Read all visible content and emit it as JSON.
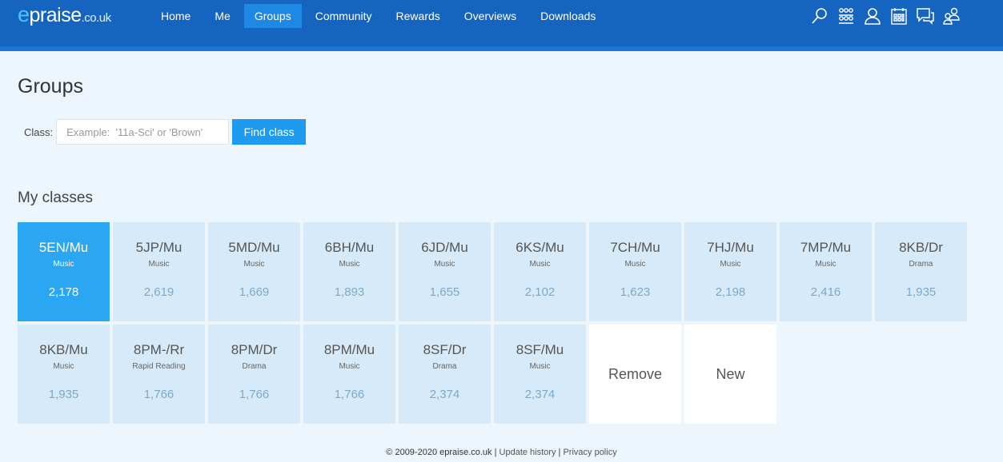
{
  "header": {
    "logo_e": "e",
    "logo_main": "praise",
    "logo_domain": ".co.uk",
    "nav": [
      {
        "label": "Home"
      },
      {
        "label": "Me"
      },
      {
        "label": "Groups",
        "active": true
      },
      {
        "label": "Community"
      },
      {
        "label": "Rewards"
      },
      {
        "label": "Overviews"
      },
      {
        "label": "Downloads"
      }
    ],
    "icons": [
      "search-icon",
      "groups-icon",
      "user-icon",
      "calendar-icon",
      "chat-icon",
      "staff-icon"
    ],
    "colors": {
      "bar": "#1565c0",
      "active_tab": "#1e88e5"
    }
  },
  "page": {
    "title": "Groups",
    "class_label": "Class:",
    "class_placeholder": "Example:  '11a-Sci' or 'Brown'",
    "find_button": "Find class",
    "section_title": "My classes"
  },
  "classes": [
    {
      "code": "5EN/Mu",
      "subject": "Music",
      "points": "2,178",
      "selected": true
    },
    {
      "code": "5JP/Mu",
      "subject": "Music",
      "points": "2,619"
    },
    {
      "code": "5MD/Mu",
      "subject": "Music",
      "points": "1,669"
    },
    {
      "code": "6BH/Mu",
      "subject": "Music",
      "points": "1,893"
    },
    {
      "code": "6JD/Mu",
      "subject": "Music",
      "points": "1,655"
    },
    {
      "code": "6KS/Mu",
      "subject": "Music",
      "points": "2,102"
    },
    {
      "code": "7CH/Mu",
      "subject": "Music",
      "points": "1,623"
    },
    {
      "code": "7HJ/Mu",
      "subject": "Music",
      "points": "2,198"
    },
    {
      "code": "7MP/Mu",
      "subject": "Music",
      "points": "2,416"
    },
    {
      "code": "8KB/Dr",
      "subject": "Drama",
      "points": "1,935"
    },
    {
      "code": "8KB/Mu",
      "subject": "Music",
      "points": "1,935"
    },
    {
      "code": "8PM-/Rr",
      "subject": "Rapid Reading",
      "points": "1,766"
    },
    {
      "code": "8PM/Dr",
      "subject": "Drama",
      "points": "1,766"
    },
    {
      "code": "8PM/Mu",
      "subject": "Music",
      "points": "1,766"
    },
    {
      "code": "8SF/Dr",
      "subject": "Drama",
      "points": "2,374"
    },
    {
      "code": "8SF/Mu",
      "subject": "Music",
      "points": "2,374"
    }
  ],
  "actions": {
    "remove": "Remove",
    "new": "New"
  },
  "footer": {
    "copyright": "© 2009-2020 epraise.co.uk",
    "sep": " | ",
    "update_history": "Update history",
    "privacy": "Privacy policy"
  }
}
